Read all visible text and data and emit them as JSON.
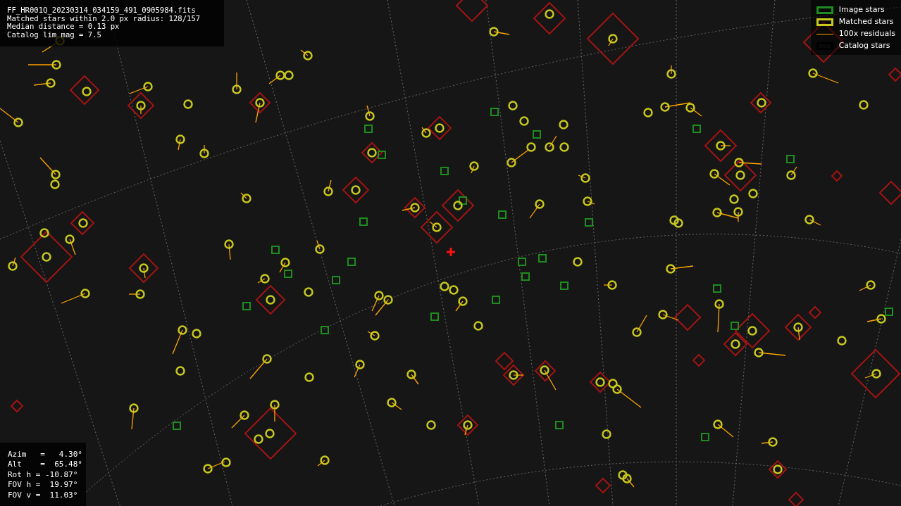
{
  "info_lines": [
    "FF_HR001Q_20230314_034159_491_0905984.fits",
    "Matched stars within 2.0 px radius: 128/157",
    "Median distance = 0.13 px",
    "Catalog lim mag = 7.5"
  ],
  "legend": [
    {
      "kind": "image",
      "label": "Image stars",
      "color": "#1e8c1e"
    },
    {
      "kind": "matched",
      "label": "Matched stars",
      "color": "#c8c81e"
    },
    {
      "kind": "residual",
      "label": "100x residuals",
      "color": "#ffa500"
    },
    {
      "kind": "catalog",
      "label": "Catalog stars",
      "color": "#000000"
    }
  ],
  "pointing": [
    "Azim   =   4.30°",
    "Alt    =  65.48°",
    "Rot h = -10.87°",
    "FOV h =  19.97°",
    "FOV v =  11.03°"
  ]
}
